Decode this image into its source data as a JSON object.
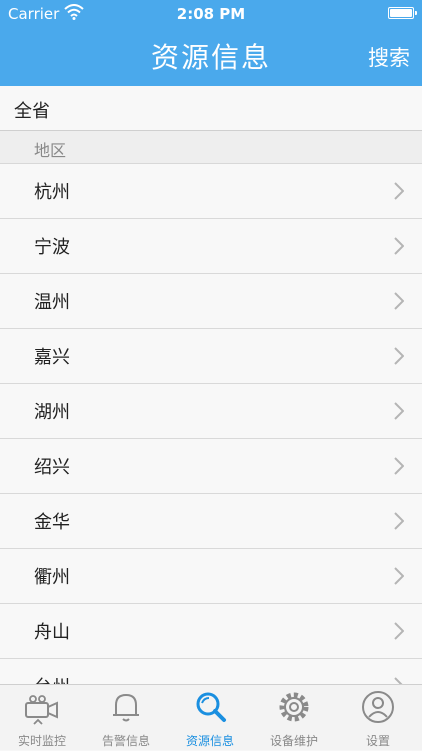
{
  "status_bar": {
    "carrier": "Carrier",
    "time": "2:08 PM"
  },
  "nav": {
    "title": "资源信息",
    "search_label": "搜索"
  },
  "province": {
    "label": "全省"
  },
  "section": {
    "label": "地区"
  },
  "regions": [
    "杭州",
    "宁波",
    "温州",
    "嘉兴",
    "湖州",
    "绍兴",
    "金华",
    "衢州",
    "舟山",
    "台州"
  ],
  "tabs": [
    {
      "label": "实时监控",
      "icon": "camera-icon"
    },
    {
      "label": "告警信息",
      "icon": "bell-icon"
    },
    {
      "label": "资源信息",
      "icon": "magnifier-icon",
      "active": true
    },
    {
      "label": "设备维护",
      "icon": "gear-icon"
    },
    {
      "label": "设置",
      "icon": "person-icon"
    }
  ],
  "colors": {
    "nav_bar": "#4aa9ec",
    "active_tab": "#1a8fe0",
    "inactive_tab": "#888888"
  }
}
